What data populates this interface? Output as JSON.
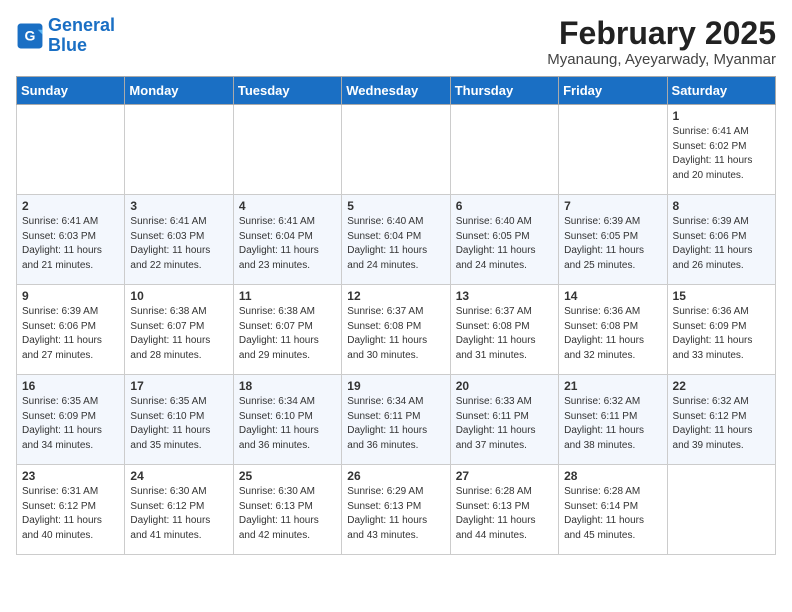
{
  "header": {
    "logo_line1": "General",
    "logo_line2": "Blue",
    "title": "February 2025",
    "subtitle": "Myanaung, Ayeyarwady, Myanmar"
  },
  "weekdays": [
    "Sunday",
    "Monday",
    "Tuesday",
    "Wednesday",
    "Thursday",
    "Friday",
    "Saturday"
  ],
  "weeks": [
    [
      {
        "day": "",
        "detail": ""
      },
      {
        "day": "",
        "detail": ""
      },
      {
        "day": "",
        "detail": ""
      },
      {
        "day": "",
        "detail": ""
      },
      {
        "day": "",
        "detail": ""
      },
      {
        "day": "",
        "detail": ""
      },
      {
        "day": "1",
        "detail": "Sunrise: 6:41 AM\nSunset: 6:02 PM\nDaylight: 11 hours\nand 20 minutes."
      }
    ],
    [
      {
        "day": "2",
        "detail": "Sunrise: 6:41 AM\nSunset: 6:03 PM\nDaylight: 11 hours\nand 21 minutes."
      },
      {
        "day": "3",
        "detail": "Sunrise: 6:41 AM\nSunset: 6:03 PM\nDaylight: 11 hours\nand 22 minutes."
      },
      {
        "day": "4",
        "detail": "Sunrise: 6:41 AM\nSunset: 6:04 PM\nDaylight: 11 hours\nand 23 minutes."
      },
      {
        "day": "5",
        "detail": "Sunrise: 6:40 AM\nSunset: 6:04 PM\nDaylight: 11 hours\nand 24 minutes."
      },
      {
        "day": "6",
        "detail": "Sunrise: 6:40 AM\nSunset: 6:05 PM\nDaylight: 11 hours\nand 24 minutes."
      },
      {
        "day": "7",
        "detail": "Sunrise: 6:39 AM\nSunset: 6:05 PM\nDaylight: 11 hours\nand 25 minutes."
      },
      {
        "day": "8",
        "detail": "Sunrise: 6:39 AM\nSunset: 6:06 PM\nDaylight: 11 hours\nand 26 minutes."
      }
    ],
    [
      {
        "day": "9",
        "detail": "Sunrise: 6:39 AM\nSunset: 6:06 PM\nDaylight: 11 hours\nand 27 minutes."
      },
      {
        "day": "10",
        "detail": "Sunrise: 6:38 AM\nSunset: 6:07 PM\nDaylight: 11 hours\nand 28 minutes."
      },
      {
        "day": "11",
        "detail": "Sunrise: 6:38 AM\nSunset: 6:07 PM\nDaylight: 11 hours\nand 29 minutes."
      },
      {
        "day": "12",
        "detail": "Sunrise: 6:37 AM\nSunset: 6:08 PM\nDaylight: 11 hours\nand 30 minutes."
      },
      {
        "day": "13",
        "detail": "Sunrise: 6:37 AM\nSunset: 6:08 PM\nDaylight: 11 hours\nand 31 minutes."
      },
      {
        "day": "14",
        "detail": "Sunrise: 6:36 AM\nSunset: 6:08 PM\nDaylight: 11 hours\nand 32 minutes."
      },
      {
        "day": "15",
        "detail": "Sunrise: 6:36 AM\nSunset: 6:09 PM\nDaylight: 11 hours\nand 33 minutes."
      }
    ],
    [
      {
        "day": "16",
        "detail": "Sunrise: 6:35 AM\nSunset: 6:09 PM\nDaylight: 11 hours\nand 34 minutes."
      },
      {
        "day": "17",
        "detail": "Sunrise: 6:35 AM\nSunset: 6:10 PM\nDaylight: 11 hours\nand 35 minutes."
      },
      {
        "day": "18",
        "detail": "Sunrise: 6:34 AM\nSunset: 6:10 PM\nDaylight: 11 hours\nand 36 minutes."
      },
      {
        "day": "19",
        "detail": "Sunrise: 6:34 AM\nSunset: 6:11 PM\nDaylight: 11 hours\nand 36 minutes."
      },
      {
        "day": "20",
        "detail": "Sunrise: 6:33 AM\nSunset: 6:11 PM\nDaylight: 11 hours\nand 37 minutes."
      },
      {
        "day": "21",
        "detail": "Sunrise: 6:32 AM\nSunset: 6:11 PM\nDaylight: 11 hours\nand 38 minutes."
      },
      {
        "day": "22",
        "detail": "Sunrise: 6:32 AM\nSunset: 6:12 PM\nDaylight: 11 hours\nand 39 minutes."
      }
    ],
    [
      {
        "day": "23",
        "detail": "Sunrise: 6:31 AM\nSunset: 6:12 PM\nDaylight: 11 hours\nand 40 minutes."
      },
      {
        "day": "24",
        "detail": "Sunrise: 6:30 AM\nSunset: 6:12 PM\nDaylight: 11 hours\nand 41 minutes."
      },
      {
        "day": "25",
        "detail": "Sunrise: 6:30 AM\nSunset: 6:13 PM\nDaylight: 11 hours\nand 42 minutes."
      },
      {
        "day": "26",
        "detail": "Sunrise: 6:29 AM\nSunset: 6:13 PM\nDaylight: 11 hours\nand 43 minutes."
      },
      {
        "day": "27",
        "detail": "Sunrise: 6:28 AM\nSunset: 6:13 PM\nDaylight: 11 hours\nand 44 minutes."
      },
      {
        "day": "28",
        "detail": "Sunrise: 6:28 AM\nSunset: 6:14 PM\nDaylight: 11 hours\nand 45 minutes."
      },
      {
        "day": "",
        "detail": ""
      }
    ]
  ]
}
